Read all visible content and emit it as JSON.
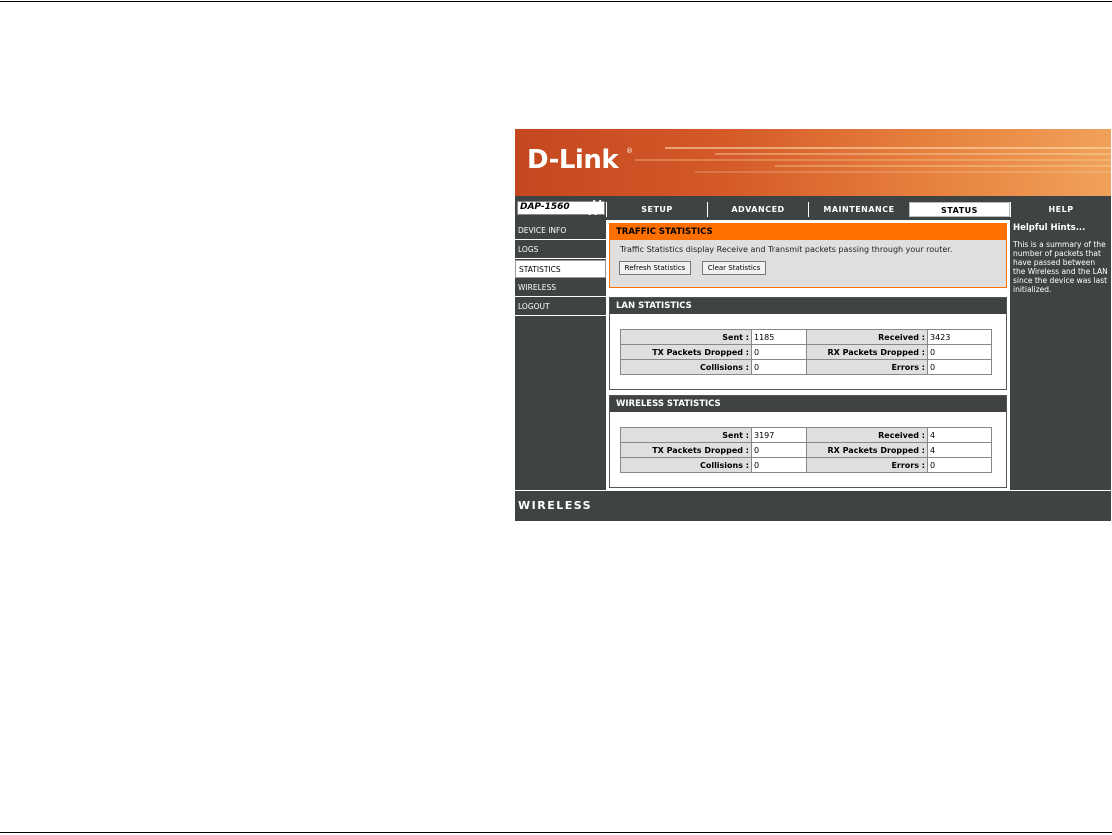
{
  "brand": {
    "logo": "D-Link",
    "reg": "®",
    "model": "DAP-1560"
  },
  "tabs": [
    {
      "label": "SETUP"
    },
    {
      "label": "ADVANCED"
    },
    {
      "label": "MAINTENANCE"
    },
    {
      "label": "STATUS"
    },
    {
      "label": "HELP"
    }
  ],
  "active_tab": "STATUS",
  "sidebar": {
    "items": [
      {
        "label": "DEVICE INFO"
      },
      {
        "label": "LOGS"
      },
      {
        "label": "STATISTICS"
      },
      {
        "label": "WIRELESS"
      },
      {
        "label": "LOGOUT"
      }
    ],
    "active": "STATISTICS"
  },
  "traffic": {
    "title": "TRAFFIC STATISTICS",
    "description": "Traffic Statistics display Receive and Transmit packets passing through your router.",
    "refresh_label": "Refresh Statistics",
    "clear_label": "Clear Statistics"
  },
  "lan": {
    "title": "LAN STATISTICS",
    "sent_label": "Sent :",
    "sent": "1185",
    "received_label": "Received :",
    "received": "3423",
    "tx_label": "TX Packets Dropped :",
    "tx": "0",
    "rx_label": "RX Packets Dropped :",
    "rx": "0",
    "collisions_label": "Collisions :",
    "collisions": "0",
    "errors_label": "Errors :",
    "errors": "0"
  },
  "wireless": {
    "title": "WIRELESS STATISTICS",
    "sent_label": "Sent :",
    "sent": "3197",
    "received_label": "Received :",
    "received": "4",
    "tx_label": "TX Packets Dropped :",
    "tx": "0",
    "rx_label": "RX Packets Dropped :",
    "rx": "4",
    "collisions_label": "Collisions :",
    "collisions": "0",
    "errors_label": "Errors :",
    "errors": "0"
  },
  "hints": {
    "title": "Helpful Hints...",
    "text": "This is a summary of the number of packets that have passed between the Wireless and the LAN since the device was last initialized."
  },
  "footer": {
    "label": "WIRELESS"
  },
  "colors": {
    "accent": "#ff6f00",
    "dark": "#404343",
    "panel": "#dfdfdf"
  }
}
